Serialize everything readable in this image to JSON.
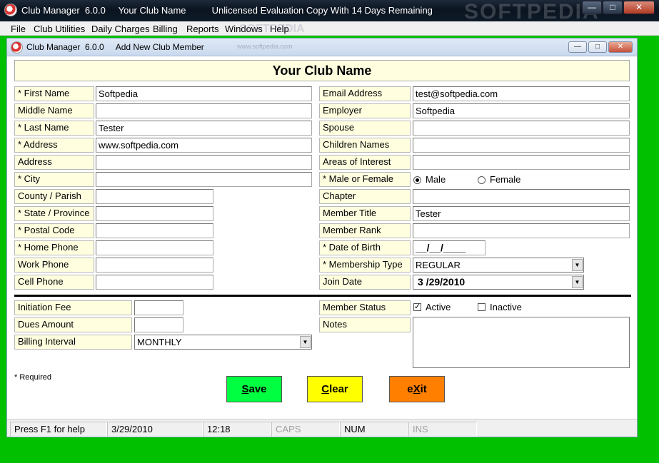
{
  "app": {
    "title": "Club Manager  6.0.0     Your Club Name          Unlicensed Evaluation Copy With 14 Days Remaining",
    "watermark": "SOFTPEDIA",
    "menu_watermark": "SOFTPEDIA"
  },
  "menu": [
    "File",
    "Club Utilities",
    "Daily Charges",
    "Billing",
    "Reports",
    "Windows",
    "Help"
  ],
  "child": {
    "title": "Club Manager  6.0.0     Add New Club Member",
    "watermark": "www.softpedia.com"
  },
  "form": {
    "club_name": "Your Club Name",
    "left": [
      {
        "label": "* First Name",
        "value": "Softpedia"
      },
      {
        "label": "Middle Name",
        "value": ""
      },
      {
        "label": "* Last Name",
        "value": "Tester"
      },
      {
        "label": "* Address",
        "value": "www.softpedia.com"
      },
      {
        "label": "Address",
        "value": ""
      },
      {
        "label": "* City",
        "value": ""
      },
      {
        "label": "County / Parish",
        "value": ""
      },
      {
        "label": "* State / Province",
        "value": ""
      },
      {
        "label": "* Postal Code",
        "value": ""
      },
      {
        "label": "* Home Phone",
        "value": ""
      },
      {
        "label": "Work Phone",
        "value": ""
      },
      {
        "label": "Cell Phone",
        "value": ""
      }
    ],
    "right": [
      {
        "label": "Email Address",
        "value": "test@softpedia.com"
      },
      {
        "label": "Employer",
        "value": "Softpedia"
      },
      {
        "label": "Spouse",
        "value": ""
      },
      {
        "label": "Children Names",
        "value": ""
      },
      {
        "label": "Areas of Interest",
        "value": ""
      },
      {
        "label": "* Male or Female",
        "value": ""
      },
      {
        "label": "Chapter",
        "value": ""
      },
      {
        "label": "Member Title",
        "value": "Tester"
      },
      {
        "label": "Member Rank",
        "value": ""
      },
      {
        "label": "* Date of Birth",
        "value": "__/__/____"
      },
      {
        "label": "* Membership Type",
        "value": "REGULAR"
      },
      {
        "label": "Join Date",
        "value": "3 /29/2010"
      }
    ],
    "gender": {
      "male": "Male",
      "female": "Female",
      "selected": "Male"
    },
    "billing": [
      {
        "label": "Initiation Fee",
        "value": ""
      },
      {
        "label": "Dues Amount",
        "value": ""
      },
      {
        "label": "Billing Interval",
        "value": "MONTHLY"
      }
    ],
    "member_status": {
      "label": "Member Status",
      "active": "Active",
      "inactive": "Inactive",
      "active_checked": true,
      "inactive_checked": false
    },
    "notes_label": "Notes",
    "required_note": "*  Required"
  },
  "buttons": {
    "save": {
      "pre": "",
      "key": "S",
      "post": "ave",
      "color": "#00ff40"
    },
    "clear": {
      "pre": "",
      "key": "C",
      "post": "lear",
      "color": "#ffff00"
    },
    "exit": {
      "pre": "e",
      "key": "X",
      "post": "it",
      "color": "#ff8000"
    }
  },
  "status_bar": {
    "help": "Press F1 for help",
    "date": "3/29/2010",
    "time": "12:18",
    "caps": "CAPS",
    "num": "NUM",
    "ins": "INS"
  }
}
